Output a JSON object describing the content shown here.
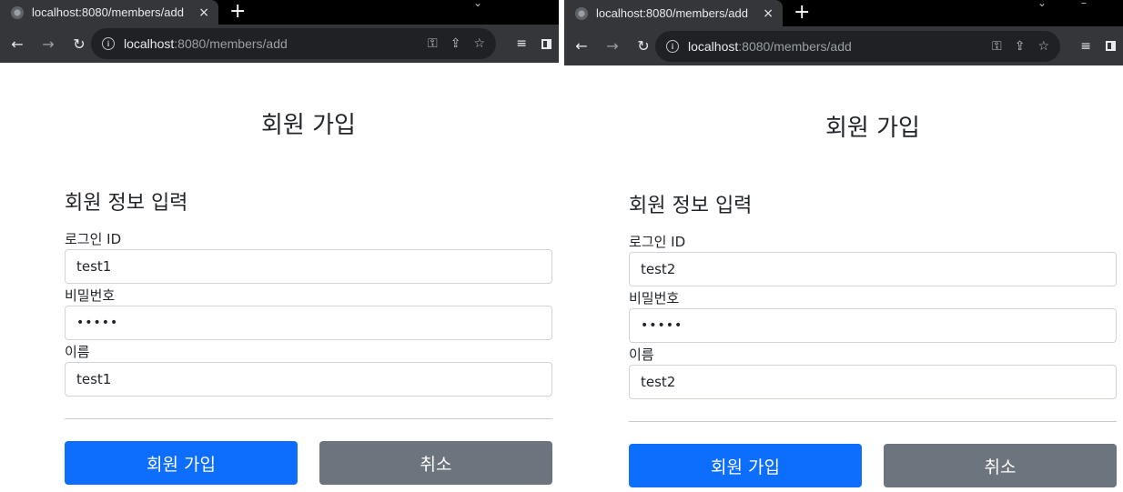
{
  "windows": [
    {
      "tab_title": "localhost:8080/members/add",
      "url_host": "localhost",
      "url_rest": ":8080/members/add",
      "page_title": "회원 가입",
      "section_title": "회원 정보 입력",
      "fields": {
        "login_id": {
          "label": "로그인 ID",
          "value": "test1"
        },
        "password": {
          "label": "비밀번호",
          "value": "•••••"
        },
        "name": {
          "label": "이름",
          "value": "test1"
        }
      },
      "buttons": {
        "submit": "회원 가입",
        "cancel": "취소"
      }
    },
    {
      "tab_title": "localhost:8080/members/add",
      "url_host": "localhost",
      "url_rest": ":8080/members/add",
      "page_title": "회원 가입",
      "section_title": "회원 정보 입력",
      "fields": {
        "login_id": {
          "label": "로그인 ID",
          "value": "test2"
        },
        "password": {
          "label": "비밀번호",
          "value": "•••••"
        },
        "name": {
          "label": "이름",
          "value": "test2"
        }
      },
      "buttons": {
        "submit": "회원 가입",
        "cancel": "취소"
      }
    }
  ],
  "icons": {
    "tab_close": "×",
    "new_tab": "+",
    "back": "←",
    "forward": "→",
    "reload": "↻",
    "info": "i",
    "key": "⚿",
    "share": "⇪",
    "star": "☆",
    "reading_list": "≡"
  },
  "colors": {
    "primary": "#0d6efd",
    "secondary": "#6c757d",
    "toolbar": "#35363a",
    "omnibox": "#202124"
  }
}
